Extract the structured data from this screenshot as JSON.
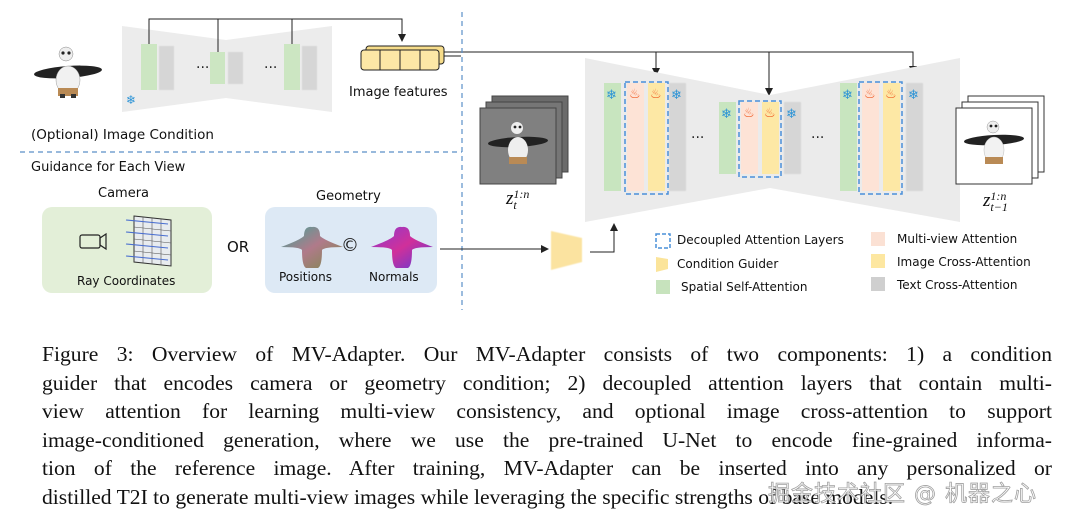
{
  "figure": {
    "top_left": {
      "image_features_label": "Image features",
      "image_condition_label": "(Optional) Image Condition",
      "ellipsis": "···"
    },
    "guidance": {
      "section_title": "Guidance for Each View",
      "camera": {
        "title": "Camera",
        "caption": "Ray Coordinates",
        "icon": "video-camera-icon"
      },
      "or_label": "OR",
      "geometry": {
        "title": "Geometry",
        "left_caption": "Positions",
        "right_caption": "Normals",
        "concat_symbol": "©"
      }
    },
    "latents": {
      "input_base": "z",
      "input_sup": "1:n",
      "input_sub": "t",
      "output_base": "z",
      "output_sup": "1:n",
      "output_sub": "t−1"
    },
    "unet_ellipsis": "···",
    "legend": [
      {
        "key": "decoupled",
        "label": "Decoupled Attention Layers",
        "color": "#4a90d9"
      },
      {
        "key": "guider",
        "label": "Condition Guider",
        "color": "#fbe49a"
      },
      {
        "key": "spatial",
        "label": "Spatial Self-Attention",
        "color": "#c7e3bd"
      },
      {
        "key": "multiview",
        "label": "Multi-view Attention",
        "color": "#fbe1d4"
      },
      {
        "key": "imagecross",
        "label": "Image Cross-Attention",
        "color": "#fde7a1"
      },
      {
        "key": "textcross",
        "label": "Text Cross-Attention",
        "color": "#cfcfcf"
      }
    ],
    "colors": {
      "spatial": "#c8e5bf",
      "multiview": "#fde3d6",
      "imagecross": "#fde8a5",
      "textcross": "#d6d6d6",
      "unet_bg": "#ebebeb",
      "dashed_border": "#4a90d9",
      "camera_box": "#e3efd8",
      "geometry_box": "#dde9f5",
      "snow": "#2b93d6",
      "fire": "#f05a22"
    },
    "icons": {
      "frozen": "snowflake-icon",
      "trainable": "fire-icon",
      "snow_glyph": "❄",
      "fire_glyph": "🔥"
    }
  },
  "caption": {
    "lines": [
      "Figure 3: Overview of MV-Adapter. Our MV-Adapter consists of two components: 1) a condition",
      "guider that encodes camera or geometry condition; 2) decoupled attention layers that contain multi-",
      "view attention for learning multi-view consistency, and optional image cross-attention to support",
      "image-conditioned generation, where we use the pre-trained U-Net to encode fine-grained informa-",
      "tion of the reference image. After training, MV-Adapter can be inserted into any personalized or",
      "distilled T2I to generate multi-view images while leveraging the specific strengths of base models."
    ]
  },
  "watermark": "掘金技术社区 @ 机器之心"
}
